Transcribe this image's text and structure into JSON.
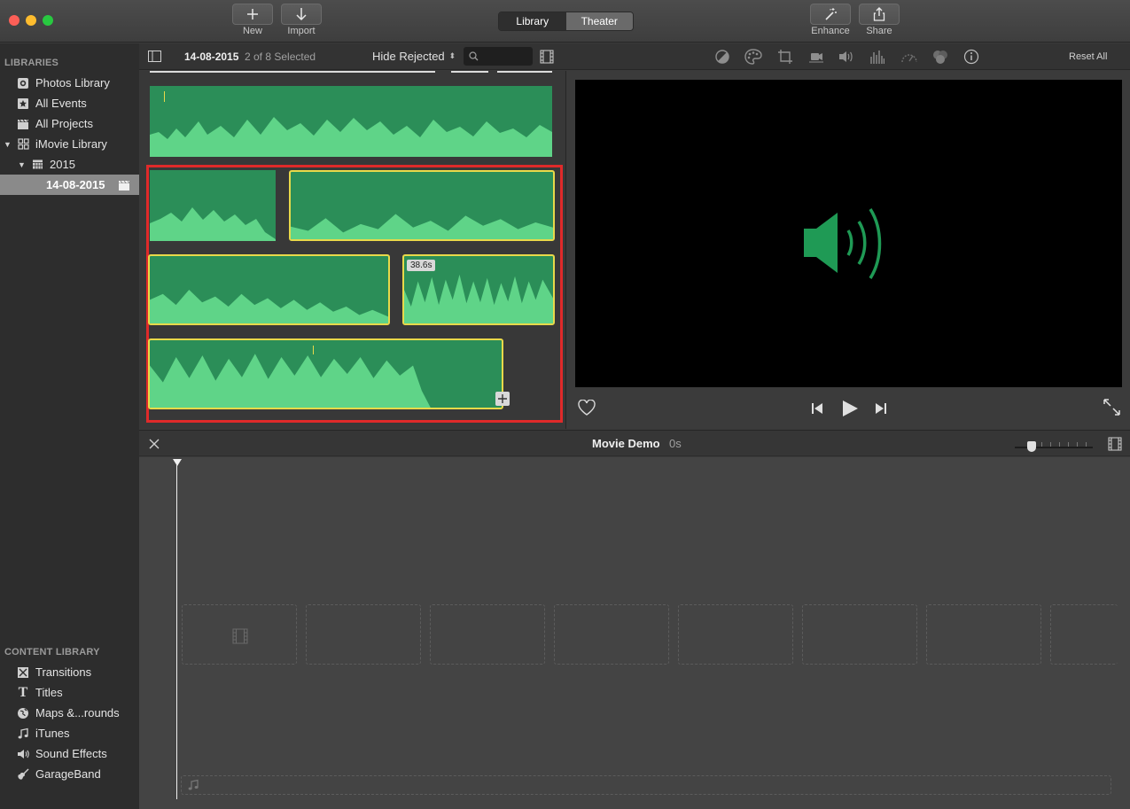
{
  "toolbar": {
    "new_label": "New",
    "import_label": "Import",
    "library_tab": "Library",
    "theater_tab": "Theater",
    "enhance_label": "Enhance",
    "share_label": "Share"
  },
  "sidebar": {
    "libraries_header": "LIBRARIES",
    "items": [
      {
        "label": "Photos Library",
        "icon": "camera-icon"
      },
      {
        "label": "All Events",
        "icon": "star-icon"
      },
      {
        "label": "All Projects",
        "icon": "clapper-icon"
      },
      {
        "label": "iMovie Library",
        "icon": "grid-icon"
      },
      {
        "label": "2015",
        "icon": "calendar-icon"
      },
      {
        "label": "14-08-2015",
        "icon": "clapper-icon"
      }
    ],
    "content_header": "CONTENT LIBRARY",
    "content_items": [
      {
        "label": "Transitions",
        "icon": "transition-icon"
      },
      {
        "label": "Titles",
        "icon": "title-t-icon"
      },
      {
        "label": "Maps &...rounds",
        "icon": "globe-icon"
      },
      {
        "label": "iTunes",
        "icon": "music-note-icon"
      },
      {
        "label": "Sound Effects",
        "icon": "speaker-icon"
      },
      {
        "label": "GarageBand",
        "icon": "guitar-icon"
      }
    ]
  },
  "browser": {
    "event_title": "14-08-2015",
    "selection_count": "2 of 8 Selected",
    "filter": "Hide Rejected",
    "search_placeholder": "",
    "clip_duration_badge": "38.6s"
  },
  "viewer": {
    "reset_label": "Reset All"
  },
  "timeline": {
    "project_title": "Movie Demo",
    "duration": "0s"
  },
  "colors": {
    "clip_green": "#2b8e58",
    "selection_yellow": "#e8d94a",
    "highlight_red": "#e02a2a",
    "speaker_green": "#1f9a55"
  }
}
